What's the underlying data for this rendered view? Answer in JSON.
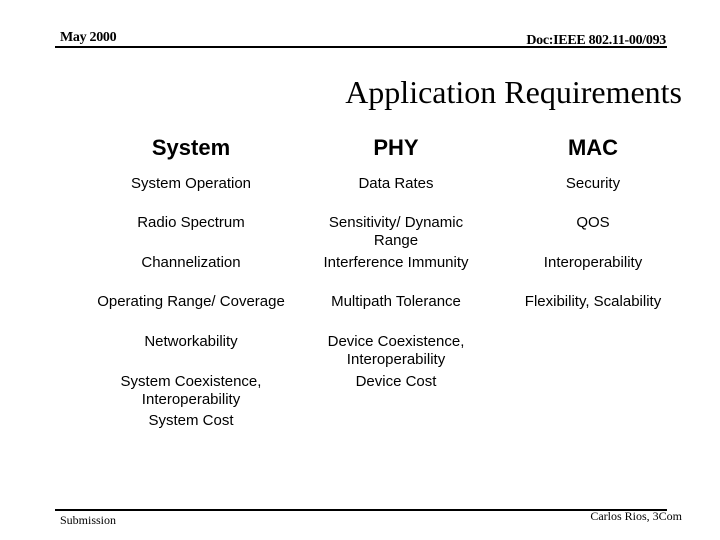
{
  "header": {
    "date": "May 2000",
    "doc_id": "Doc:IEEE 802.11-00/093"
  },
  "title": "Application Requirements",
  "columns": [
    {
      "heading": "System",
      "items": [
        "System Operation",
        "Radio Spectrum",
        "Channelization",
        "Operating Range/ Coverage",
        "Networkability",
        "System Coexistence,\nInteroperability",
        "System Cost"
      ]
    },
    {
      "heading": "PHY",
      "items": [
        "Data Rates",
        "Sensitivity/ Dynamic\nRange",
        "Interference Immunity",
        "Multipath Tolerance",
        "Device Coexistence,\nInteroperability",
        "Device Cost"
      ]
    },
    {
      "heading": "MAC",
      "items": [
        "Security",
        "QOS",
        "Interoperability",
        "Flexibility, Scalability"
      ]
    }
  ],
  "footer": {
    "left": "Submission",
    "right": "Carlos Rios, 3Com"
  }
}
